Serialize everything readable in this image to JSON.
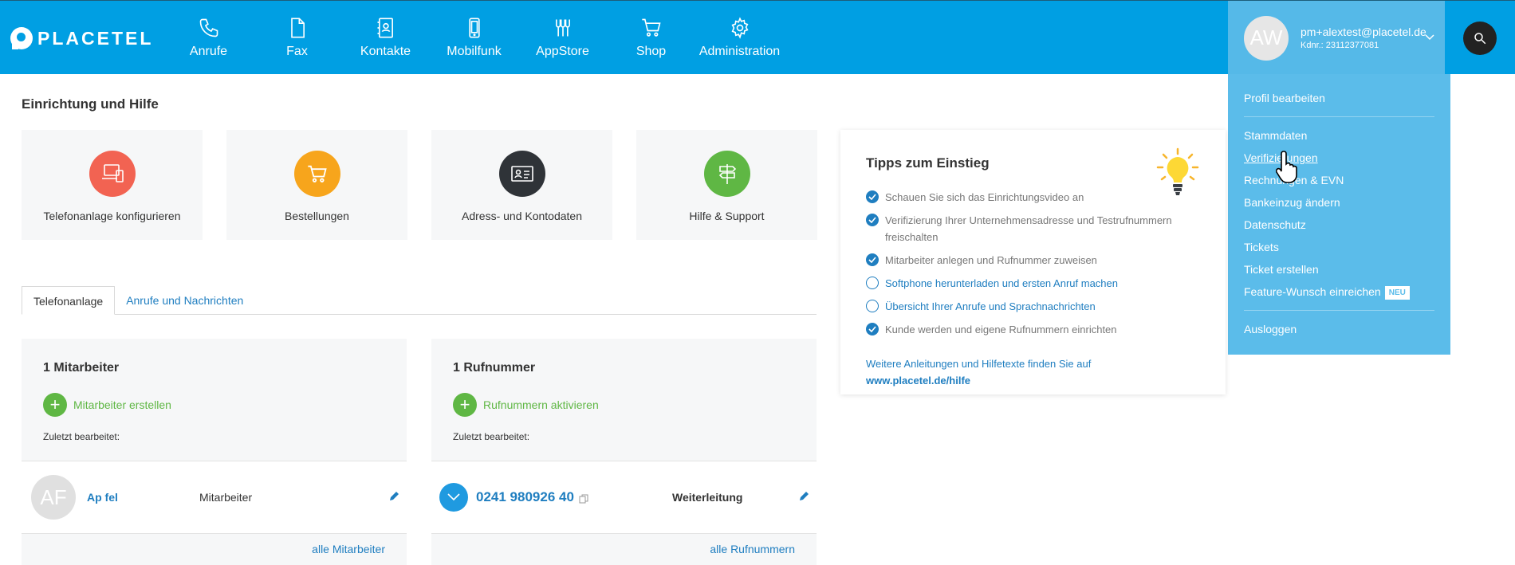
{
  "brand": {
    "name": "PLACETEL",
    "color": "#009fe3"
  },
  "nav": [
    {
      "label": "Anrufe",
      "icon": "phone-icon"
    },
    {
      "label": "Fax",
      "icon": "fax-icon"
    },
    {
      "label": "Kontakte",
      "icon": "contacts-icon"
    },
    {
      "label": "Mobilfunk",
      "icon": "mobile-icon"
    },
    {
      "label": "AppStore",
      "icon": "appstore-icon"
    },
    {
      "label": "Shop",
      "icon": "cart-icon"
    },
    {
      "label": "Administration",
      "icon": "gear-icon"
    }
  ],
  "user": {
    "initials": "AW",
    "email": "pm+alextest@placetel.de",
    "customer": "Kdnr.: 23112377081"
  },
  "dropdown": {
    "profile": "Profil bearbeiten",
    "items": [
      "Stammdaten",
      "Verifizierungen",
      "Rechnungen & EVN",
      "Bankeinzug ändern",
      "Datenschutz",
      "Tickets",
      "Ticket erstellen"
    ],
    "feature": "Feature-Wunsch einreichen",
    "feature_badge": "NEU",
    "logout": "Ausloggen"
  },
  "setup": {
    "title": "Einrichtung und Hilfe",
    "cards": [
      {
        "label": "Telefonanlage konfigurieren",
        "color": "#f26352",
        "icon": "devices-icon"
      },
      {
        "label": "Bestellungen",
        "color": "#f7a51c",
        "icon": "cart-icon"
      },
      {
        "label": "Adress- und Kontodaten",
        "color": "#2f3338",
        "icon": "id-card-icon"
      },
      {
        "label": "Hilfe & Support",
        "color": "#5fb744",
        "icon": "signpost-icon"
      }
    ]
  },
  "tips": {
    "title": "Tipps zum Einstieg",
    "items": [
      {
        "text": "Schauen Sie sich das Einrichtungsvideo an",
        "done": true
      },
      {
        "text": "Verifizierung Ihrer Unternehmensadresse und Testrufnummern freischalten",
        "done": true
      },
      {
        "text": "Mitarbeiter anlegen und Rufnummer zuweisen",
        "done": true
      },
      {
        "text": "Softphone herunterladen und ersten Anruf machen",
        "done": false
      },
      {
        "text": "Übersicht Ihrer Anrufe und Sprachnachrichten",
        "done": false
      },
      {
        "text": "Kunde werden und eigene Rufnummern einrichten",
        "done": true
      }
    ],
    "footer": "Weitere Anleitungen und Hilfetexte finden Sie auf",
    "link": "www.placetel.de/hilfe"
  },
  "tabs": [
    "Telefonanlage",
    "Anrufe und Nachrichten"
  ],
  "employees": {
    "title": "1 Mitarbeiter",
    "add": "Mitarbeiter erstellen",
    "recent": "Zuletzt bearbeitet:",
    "row": {
      "initials": "AF",
      "name": "Ap fel",
      "role": "Mitarbeiter"
    },
    "all": "alle Mitarbeiter"
  },
  "numbers": {
    "title": "1 Rufnummer",
    "add": "Rufnummern aktivieren",
    "recent": "Zuletzt bearbeitet:",
    "row": {
      "number": "0241 980926 40",
      "type": "Weiterleitung"
    },
    "all": "alle Rufnummern"
  }
}
